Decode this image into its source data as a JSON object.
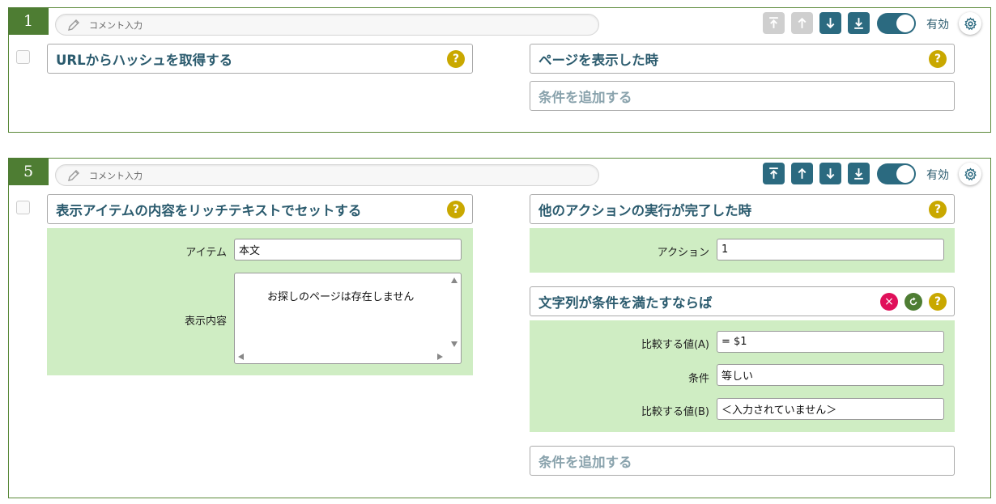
{
  "card1": {
    "number": "1",
    "comment_placeholder": "コメント入力",
    "toggle_label": "有効",
    "action_title": "URLからハッシュを取得する",
    "trigger_title": "ページを表示した時",
    "add_condition": "条件を追加する",
    "controls_enabled": {
      "move_top": false,
      "move_up": false,
      "move_down": true,
      "move_bottom": true
    }
  },
  "card2": {
    "number": "5",
    "comment_placeholder": "コメント入力",
    "toggle_label": "有効",
    "action_title": "表示アイテムの内容をリッチテキストでセットする",
    "action_fields": {
      "item_label": "アイテム",
      "item_value": "本文",
      "content_label": "表示内容",
      "content_value": "お探しのページは存在しません"
    },
    "trigger_title": "他のアクションの実行が完了した時",
    "trigger_fields": {
      "action_label": "アクション",
      "action_value": "1"
    },
    "condition_title": "文字列が条件を満たすならば",
    "condition_fields": {
      "compare_a_label": "比較する値(A)",
      "compare_a_value": "= $1",
      "condition_label": "条件",
      "condition_value": "等しい",
      "compare_b_label": "比較する値(B)",
      "compare_b_value": "＜入力されていません＞"
    },
    "add_condition": "条件を追加する",
    "controls_enabled": {
      "move_top": true,
      "move_up": true,
      "move_down": true,
      "move_bottom": true
    }
  },
  "icons": {
    "help": "?",
    "delete": "×"
  },
  "colors": {
    "accent": "#2b6a80",
    "green": "#4e7d33",
    "panel": "#cfedc3",
    "help": "#c9a800",
    "delete": "#e0105a",
    "disabled": "#cfcfcf"
  }
}
